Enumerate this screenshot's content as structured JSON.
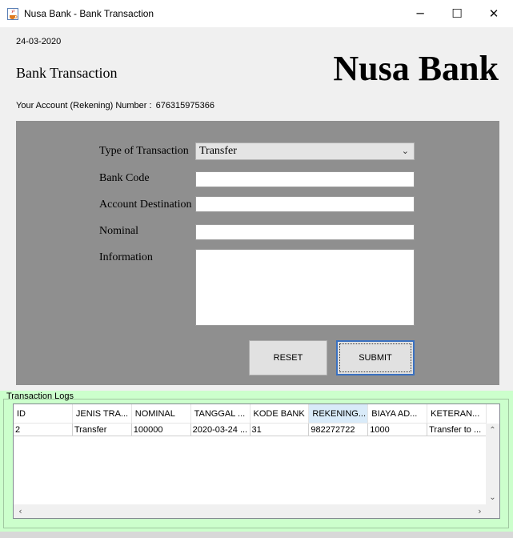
{
  "window": {
    "title": "Nusa Bank - Bank Transaction",
    "minimize": "─",
    "maximize": "☐",
    "close": "✕"
  },
  "header": {
    "date": "24-03-2020",
    "page_title": "Bank Transaction",
    "brand": "Nusa Bank",
    "account_label": "Your Account (Rekening) Number :",
    "account_number": "676315975366"
  },
  "form": {
    "type_label": "Type of Transaction",
    "type_value": "Transfer",
    "bank_code_label": "Bank Code",
    "bank_code_value": "",
    "destination_label": "Account Destination",
    "destination_value": "",
    "nominal_label": "Nominal",
    "nominal_value": "",
    "information_label": "Information",
    "information_value": "",
    "reset_label": "RESET",
    "submit_label": "SUBMIT"
  },
  "logs": {
    "title": "Transaction Logs",
    "columns": [
      "ID",
      "JENIS TRA...",
      "NOMINAL",
      "TANGGAL ...",
      "KODE BANK",
      "REKENING...",
      "BIAYA AD...",
      "KETERAN..."
    ],
    "rows": [
      [
        "2",
        "Transfer",
        "100000",
        "2020-03-24 ...",
        "31",
        "982272722",
        "1000",
        "Transfer to ..."
      ]
    ]
  },
  "colors": {
    "form_panel_bg": "#8f8f8f",
    "logs_panel_bg": "#ccffcc",
    "focus_border": "#3a71c1"
  },
  "icons": {
    "app": "java-cup-icon",
    "dropdown": "chevron-down-icon",
    "scroll_up": "chevron-up-icon",
    "scroll_down": "chevron-down-icon",
    "scroll_left": "chevron-left-icon",
    "scroll_right": "chevron-right-icon"
  }
}
